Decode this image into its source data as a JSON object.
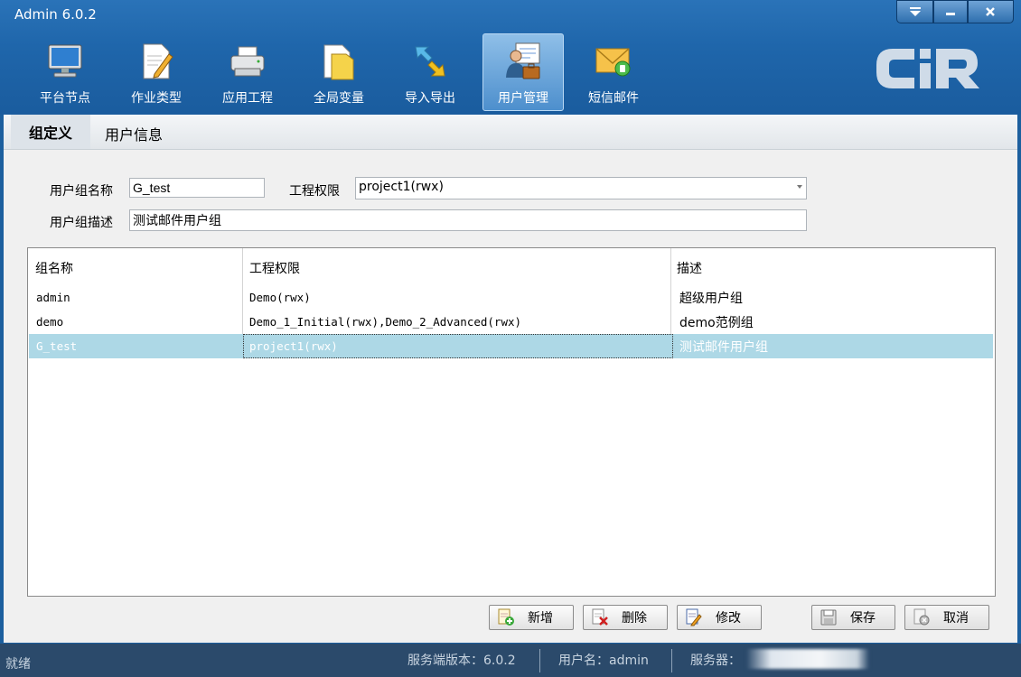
{
  "window": {
    "title": "Admin 6.0.2"
  },
  "toolbar": [
    {
      "label": "平台节点",
      "icon": "monitor-icon"
    },
    {
      "label": "作业类型",
      "icon": "document-pen-icon"
    },
    {
      "label": "应用工程",
      "icon": "printer-icon"
    },
    {
      "label": "全局变量",
      "icon": "folder-doc-icon"
    },
    {
      "label": "导入导出",
      "icon": "import-export-arrows-icon"
    },
    {
      "label": "用户管理",
      "icon": "user-management-icon",
      "active": true
    },
    {
      "label": "短信邮件",
      "icon": "envelope-icon"
    }
  ],
  "logo": {
    "text": "CiR"
  },
  "tabs": {
    "group_def": "组定义",
    "user_info": "用户信息"
  },
  "form": {
    "group_name_label": "用户组名称",
    "group_name_value": "G_test",
    "permission_label": "工程权限",
    "permission_value": "project1(rwx)",
    "desc_label": "用户组描述",
    "desc_value": "测试邮件用户组"
  },
  "grid": {
    "columns": [
      "组名称",
      "工程权限",
      "描述"
    ],
    "rows": [
      [
        "admin",
        "Demo(rwx)",
        "超级用户组"
      ],
      [
        "demo",
        "Demo_1_Initial(rwx),Demo_2_Advanced(rwx)",
        "demo范例组"
      ],
      [
        "G_test",
        "project1(rwx)",
        "测试邮件用户组"
      ]
    ],
    "selected_row": 2
  },
  "buttons": {
    "add": "新增",
    "delete": "删除",
    "modify": "修改",
    "save": "保存",
    "cancel": "取消"
  },
  "status": {
    "ready": "就绪",
    "server_version": "服务端版本：6.0.2",
    "username": "用户名：admin",
    "server": "服务器："
  },
  "colors": {
    "title_bar": "#1f66ab",
    "selected_row": "#add8e6",
    "status_bar": "#2b4a6b"
  }
}
